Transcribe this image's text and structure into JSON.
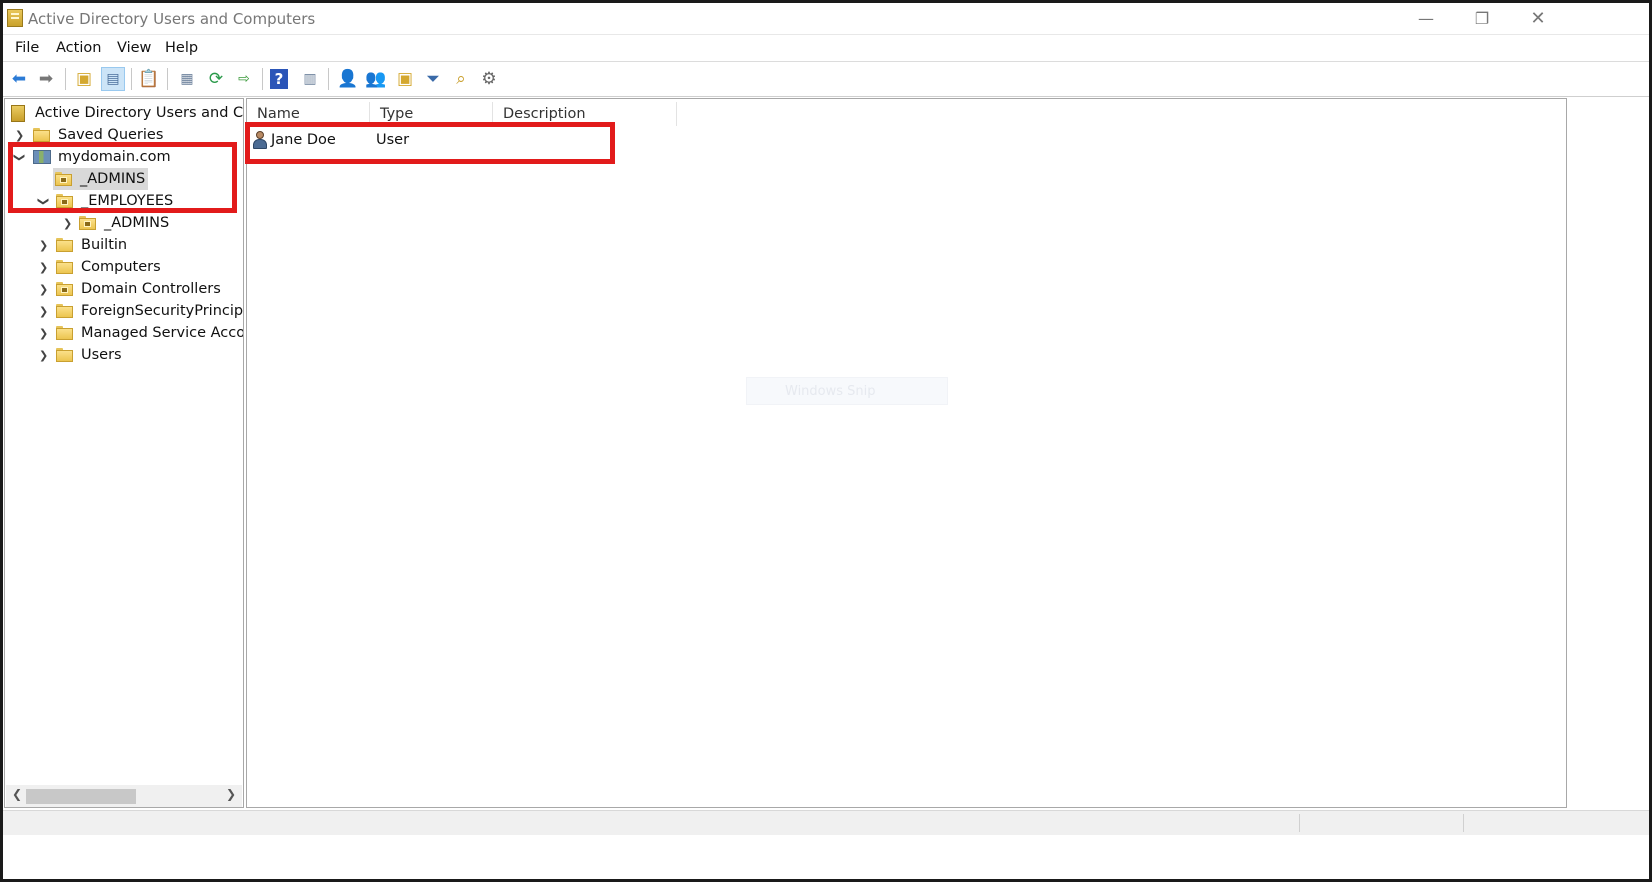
{
  "window": {
    "title": "Active Directory Users and Computers",
    "controls": {
      "minimize": "—",
      "maximize": "❐",
      "close": "✕"
    }
  },
  "menu": [
    "File",
    "Action",
    "View",
    "Help"
  ],
  "toolbar": {
    "buttons": [
      "back-icon",
      "forward-icon",
      "up-folder-icon",
      "show-hide-console-tree-icon",
      "clipboard-icon",
      "properties-icon",
      "refresh-icon",
      "export-list-icon",
      "help-icon",
      "toggle-pane-icon",
      "new-user-icon",
      "new-group-icon",
      "new-ou-icon",
      "filter-icon",
      "find-icon",
      "delegate-icon"
    ]
  },
  "tree": {
    "root": "Active Directory Users and Comp",
    "items": [
      {
        "label": "Saved Queries",
        "expanded": false
      },
      {
        "label": "mydomain.com",
        "expanded": true
      },
      {
        "label": "_ADMINS",
        "selected": true
      },
      {
        "label": "_EMPLOYEES",
        "expanded": true
      },
      {
        "label": "_ADMINS"
      },
      {
        "label": "Builtin"
      },
      {
        "label": "Computers"
      },
      {
        "label": "Domain Controllers"
      },
      {
        "label": "ForeignSecurityPrincipals"
      },
      {
        "label": "Managed Service Accoun"
      },
      {
        "label": "Users"
      }
    ]
  },
  "list": {
    "columns": [
      "Name",
      "Type",
      "Description"
    ],
    "rows": [
      {
        "name": "Jane Doe",
        "type": "User",
        "description": ""
      }
    ]
  },
  "ghost_text": "Windows Snip",
  "annotation_color": "#e21b1b"
}
